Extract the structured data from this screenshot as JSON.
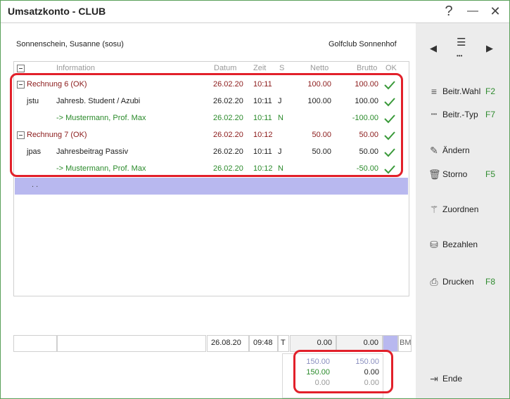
{
  "window": {
    "title": "Umsatzkonto - CLUB",
    "help": "?",
    "minimize": "—",
    "close": "✕"
  },
  "header": {
    "member": "Sonnenschein, Susanne (sosu)",
    "club": "Golfclub Sonnenhof"
  },
  "columns": {
    "information": "Information",
    "datum": "Datum",
    "zeit": "Zeit",
    "s": "S",
    "netto": "Netto",
    "brutto": "Brutto",
    "ok": "OK"
  },
  "rows": [
    {
      "code": "",
      "info": "Rechnung 6 (OK)",
      "datum": "26.02.20",
      "zeit": "10:11",
      "s": "",
      "netto": "100.00",
      "brutto": "100.00"
    },
    {
      "code": "jstu",
      "info": "Jahresb. Student / Azubi",
      "datum": "26.02.20",
      "zeit": "10:11",
      "s": "J",
      "netto": "100.00",
      "brutto": "100.00"
    },
    {
      "code": "",
      "info": "-> Mustermann, Prof. Max",
      "datum": "26.02.20",
      "zeit": "10:11",
      "s": "N",
      "netto": "",
      "brutto": "-100.00"
    },
    {
      "code": "",
      "info": "Rechnung 7 (OK)",
      "datum": "26.02.20",
      "zeit": "10:12",
      "s": "",
      "netto": "50.00",
      "brutto": "50.00"
    },
    {
      "code": "jpas",
      "info": "Jahresbeitrag Passiv",
      "datum": "26.02.20",
      "zeit": "10:11",
      "s": "J",
      "netto": "50.00",
      "brutto": "50.00"
    },
    {
      "code": "",
      "info": "-> Mustermann, Prof. Max",
      "datum": "26.02.20",
      "zeit": "10:12",
      "s": "N",
      "netto": "",
      "brutto": "-50.00"
    }
  ],
  "selected_row": {
    "text": ". ."
  },
  "status": {
    "datum": "26.08.20",
    "zeit": "09:48",
    "s": "T",
    "netto": "0.00",
    "brutto": "0.00",
    "extra": "BM"
  },
  "totals": [
    {
      "netto": "150.00",
      "brutto": "150.00"
    },
    {
      "netto": "150.00",
      "brutto": "0.00"
    },
    {
      "netto": "0.00",
      "brutto": "0.00"
    }
  ],
  "sidebar": {
    "prev": "◀",
    "menu": "☰",
    "more": "•••",
    "next": "▶",
    "buttons": [
      {
        "label": "Beitr.Wahl",
        "key": "F2",
        "icon": "list-icon"
      },
      {
        "label": "Beitr.-Typ",
        "key": "F7",
        "icon": "dots-icon"
      },
      {
        "label": "Ändern",
        "key": "",
        "icon": "pencil-icon"
      },
      {
        "label": "Storno",
        "key": "F5",
        "icon": "trash-icon"
      },
      {
        "label": "Zuordnen",
        "key": "",
        "icon": "magic-wand-icon"
      },
      {
        "label": "Bezahlen",
        "key": "",
        "icon": "coins-icon"
      },
      {
        "label": "Drucken",
        "key": "F8",
        "icon": "printer-icon"
      },
      {
        "label": "Ende",
        "key": "",
        "icon": "exit-icon"
      }
    ]
  },
  "colors": {
    "accent_green": "#2a8a2a",
    "invoice_red": "#8b1a1a",
    "highlight_red": "#e2202a",
    "selection": "#b8b8ef"
  }
}
